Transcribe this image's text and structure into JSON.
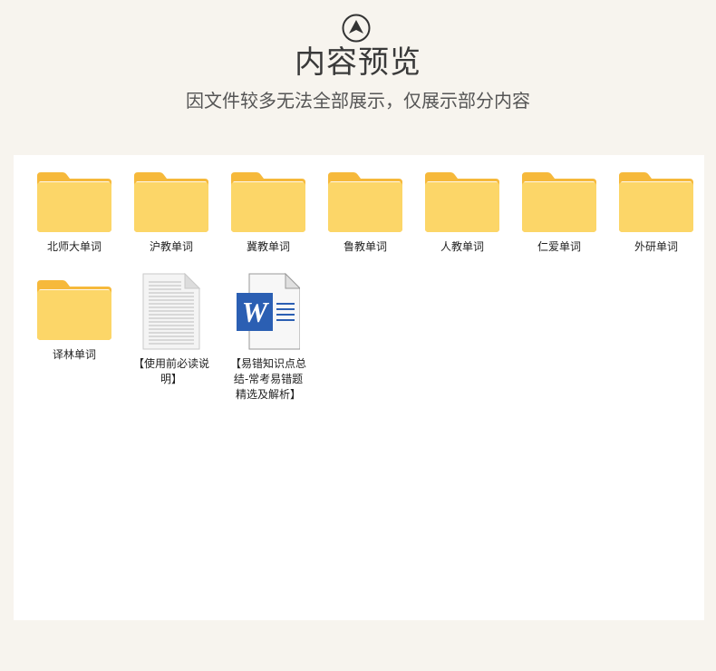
{
  "header": {
    "title": "内容预览",
    "subtitle": "因文件较多无法全部展示，仅展示部分内容",
    "icon": "up-arrow-circle-icon"
  },
  "colors": {
    "background": "#f7f4ee",
    "folder_back": "#f6b93b",
    "folder_front": "#fcd668",
    "word_blue": "#2b5fb3"
  },
  "files": [
    {
      "type": "folder",
      "name": "北师大单词"
    },
    {
      "type": "folder",
      "name": "沪教单词"
    },
    {
      "type": "folder",
      "name": "冀教单词"
    },
    {
      "type": "folder",
      "name": "鲁教单词"
    },
    {
      "type": "folder",
      "name": "人教单词"
    },
    {
      "type": "folder",
      "name": "仁爱单词"
    },
    {
      "type": "folder",
      "name": "外研单词"
    },
    {
      "type": "folder",
      "name": "译林单词"
    },
    {
      "type": "text-file",
      "name": "【使用前必读说明】"
    },
    {
      "type": "word-file",
      "name": "【易错知识点总结-常考易错题精选及解析】"
    }
  ]
}
